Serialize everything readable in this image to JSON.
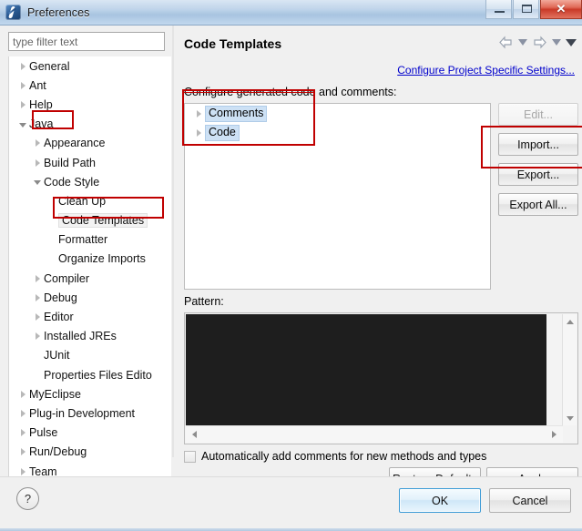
{
  "window": {
    "title": "Preferences",
    "icon": "myeclipse-icon",
    "controls": {
      "minimize": "minimize-icon",
      "maximize": "maximize-icon",
      "close": "✕"
    }
  },
  "sidebar": {
    "filter": {
      "placeholder": "type filter text",
      "value": ""
    },
    "items": [
      {
        "label": "General",
        "indent": 0,
        "state": "collapsed",
        "selected": false
      },
      {
        "label": "Ant",
        "indent": 0,
        "state": "collapsed",
        "selected": false
      },
      {
        "label": "Help",
        "indent": 0,
        "state": "collapsed",
        "selected": false
      },
      {
        "label": "Java",
        "indent": 0,
        "state": "expanded",
        "selected": false
      },
      {
        "label": "Appearance",
        "indent": 1,
        "state": "collapsed",
        "selected": false
      },
      {
        "label": "Build Path",
        "indent": 1,
        "state": "collapsed",
        "selected": false
      },
      {
        "label": "Code Style",
        "indent": 1,
        "state": "expanded",
        "selected": false
      },
      {
        "label": "Clean Up",
        "indent": 2,
        "state": "none",
        "selected": false
      },
      {
        "label": "Code Templates",
        "indent": 2,
        "state": "none",
        "selected": true
      },
      {
        "label": "Formatter",
        "indent": 2,
        "state": "none",
        "selected": false
      },
      {
        "label": "Organize Imports",
        "indent": 2,
        "state": "none",
        "selected": false
      },
      {
        "label": "Compiler",
        "indent": 1,
        "state": "collapsed",
        "selected": false
      },
      {
        "label": "Debug",
        "indent": 1,
        "state": "collapsed",
        "selected": false
      },
      {
        "label": "Editor",
        "indent": 1,
        "state": "collapsed",
        "selected": false
      },
      {
        "label": "Installed JREs",
        "indent": 1,
        "state": "collapsed",
        "selected": false
      },
      {
        "label": "JUnit",
        "indent": 1,
        "state": "none",
        "selected": false
      },
      {
        "label": "Properties Files Edito",
        "indent": 1,
        "state": "none",
        "selected": false
      },
      {
        "label": "MyEclipse",
        "indent": 0,
        "state": "collapsed",
        "selected": false
      },
      {
        "label": "Plug-in Development",
        "indent": 0,
        "state": "collapsed",
        "selected": false
      },
      {
        "label": "Pulse",
        "indent": 0,
        "state": "collapsed",
        "selected": false
      },
      {
        "label": "Run/Debug",
        "indent": 0,
        "state": "collapsed",
        "selected": false
      },
      {
        "label": "Team",
        "indent": 0,
        "state": "collapsed",
        "selected": false
      }
    ],
    "hscrollbar": {
      "left_arrow": "scroll-left-icon",
      "right_arrow": "scroll-right-icon",
      "grip": "grip-icon"
    }
  },
  "main": {
    "title": "Code Templates",
    "nav": {
      "back": "back-arrow-icon",
      "back_menu": "chevron-down-icon",
      "forward": "forward-arrow-icon",
      "forward_menu": "chevron-down-icon",
      "view_menu": "chevron-down-solid-icon"
    },
    "project_settings_link": "Configure Project Specific Settings...",
    "group_label": "Configure generated code and comments:",
    "template_tree": [
      {
        "label": "Comments",
        "state": "collapsed",
        "highlighted": true
      },
      {
        "label": "Code",
        "state": "collapsed",
        "highlighted": true
      }
    ],
    "side_buttons": [
      {
        "label": "Edit...",
        "disabled": true
      },
      {
        "label": "Import...",
        "disabled": false
      },
      {
        "label": "Export...",
        "disabled": false
      },
      {
        "label": "Export All...",
        "disabled": false
      }
    ],
    "pattern_label": "Pattern:",
    "pattern_value": "",
    "pattern_scroll": {
      "up": "scroll-up-icon",
      "down": "scroll-down-icon",
      "left": "scroll-left-icon",
      "right": "scroll-right-icon"
    },
    "auto_comments_checkbox": {
      "label": "Automatically add comments for new methods and types",
      "checked": false
    },
    "restore_defaults_label": "Restore Defaults",
    "apply_label": "Apply"
  },
  "footer": {
    "help": "?",
    "ok_label": "OK",
    "cancel_label": "Cancel"
  },
  "colors": {
    "annotation_red": "#c00000",
    "link_blue": "#0000cc",
    "selection_blue": "#cde1f5",
    "titlebar_blue": "#a8c4e0",
    "close_red": "#c93a28",
    "pattern_bg": "#1e1e1e"
  }
}
